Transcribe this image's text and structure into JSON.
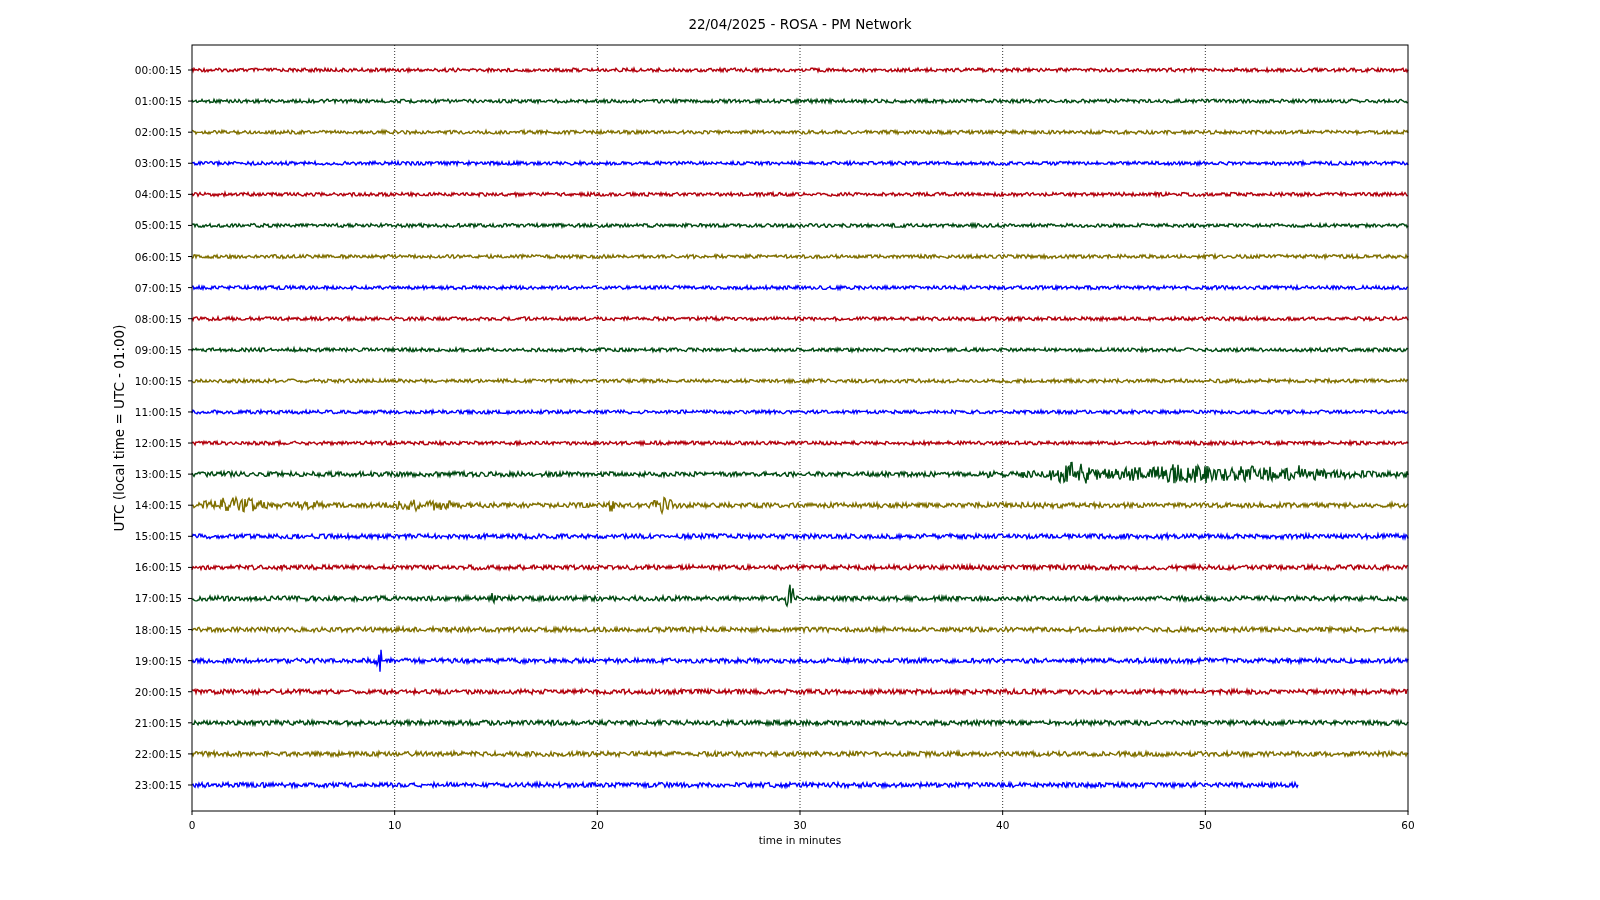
{
  "title": "22/04/2025 - ROSA - PM Network",
  "y_axis": {
    "label": "UTC (local time = UTC - 01:00)"
  },
  "x_axis": {
    "label": "time in minutes",
    "ticks": [
      "0",
      "10",
      "20",
      "30",
      "40",
      "50",
      "60"
    ]
  },
  "traces": [
    {
      "label": "00:00:15",
      "color": "#b2000c",
      "level": 1
    },
    {
      "label": "01:00:15",
      "color": "#004a12",
      "level": 1
    },
    {
      "label": "02:00:15",
      "color": "#807000",
      "level": 1
    },
    {
      "label": "03:00:15",
      "color": "#0000ff",
      "level": 1
    },
    {
      "label": "04:00:15",
      "color": "#b2000c",
      "level": 1
    },
    {
      "label": "05:00:15",
      "color": "#004a12",
      "level": 1
    },
    {
      "label": "06:00:15",
      "color": "#807000",
      "level": 1
    },
    {
      "label": "07:00:15",
      "color": "#0000ff",
      "level": 1
    },
    {
      "label": "08:00:15",
      "color": "#b2000c",
      "level": 1
    },
    {
      "label": "09:00:15",
      "color": "#004a12",
      "level": 1
    },
    {
      "label": "10:00:15",
      "color": "#807000",
      "level": 1
    },
    {
      "label": "11:00:15",
      "color": "#0000ff",
      "level": 1
    },
    {
      "label": "12:00:15",
      "color": "#b2000c",
      "level": 1
    },
    {
      "label": "13:00:15",
      "color": "#004a12",
      "level": 1
    },
    {
      "label": "14:00:15",
      "color": "#807000",
      "level": 1
    },
    {
      "label": "15:00:15",
      "color": "#0000ff",
      "level": 1
    },
    {
      "label": "16:00:15",
      "color": "#b2000c",
      "level": 1
    },
    {
      "label": "17:00:15",
      "color": "#004a12",
      "level": 1
    },
    {
      "label": "18:00:15",
      "color": "#807000",
      "level": 1
    },
    {
      "label": "19:00:15",
      "color": "#0000ff",
      "level": 1
    },
    {
      "label": "20:00:15",
      "color": "#b2000c",
      "level": 1
    },
    {
      "label": "21:00:15",
      "color": "#004a12",
      "level": 1
    },
    {
      "label": "22:00:15",
      "color": "#807000",
      "level": 1
    },
    {
      "label": "23:00:15",
      "color": "#0000ff",
      "level": 0.91
    }
  ]
}
